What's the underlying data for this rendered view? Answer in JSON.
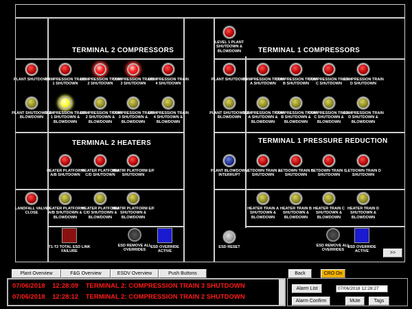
{
  "terminal2": {
    "compressors_title": "TERMINAL 2   COMPRESSORS",
    "heaters_title": "TERMINAL 2      HEATERS",
    "compressor_shutdown": [
      {
        "label": "PLANT SHUTDOWN",
        "state": "red"
      },
      {
        "label": "COMPRESSION TRAIN 1 SHUTDOWN",
        "state": "red"
      },
      {
        "label": "COMPRESSION TRAIN 2 SHUTDOWN",
        "state": "redon"
      },
      {
        "label": "COMPRESSION TRAIN 3 SHUTDOWN",
        "state": "redon"
      },
      {
        "label": "COMPRESSION TRAIN 4 SHUTDOWN",
        "state": "red"
      }
    ],
    "compressor_blowdown": [
      {
        "label": "PLANT SHUTDOWN & BLOWDOWN",
        "state": "yel"
      },
      {
        "label": "COMPRESSION TRAIN 1 SHUTDOWN & BLOWDOWN",
        "state": "yelon"
      },
      {
        "label": "COMPRESSION TRAIN 2 SHUTDOWN & BLOWDOWN",
        "state": "yel"
      },
      {
        "label": "COMPRESSION TRAIN 3 SHUTDOWN & BLOWDOWN",
        "state": "yel"
      },
      {
        "label": "COMPRESSION TRAIN 4 SHUTDOWN & BLOWDOWN",
        "state": "yel"
      }
    ],
    "heater_shutdown": [
      {
        "label": "HEATER PLATFORM A/B SHUTDOWN",
        "state": "red"
      },
      {
        "label": "HEATER PLATFORM C/D SHUTDOWN",
        "state": "red"
      },
      {
        "label": "HEATIR PLATFORM E/F SHUTDOWN",
        "state": "red"
      }
    ],
    "landfall": {
      "label": "LANDFALL VALVE CLOSE",
      "state": "red"
    },
    "heater_blowdown": [
      {
        "label": "HEATER PLATFORM A/B SHUTDOWN & BLOWDOWN",
        "state": "yel"
      },
      {
        "label": "HEATER PLATFORM C/D SHUTDOWN & BLOWDOWN",
        "state": "yel"
      },
      {
        "label": "HEATIR PLATFORM E/F SHUTDOWN & BLOWDOWN",
        "state": "yel"
      }
    ],
    "link_failure": {
      "label": "T1-T2 TOTAL ESD LINK FAILURE",
      "color": "#8a1010"
    },
    "esd_remove": {
      "label": "ESD REMOVE ALL OVERRIDES"
    },
    "esd_override": {
      "label": "ESD OVERRIDE ACTIVE",
      "color": "#1a1ad0"
    }
  },
  "terminal1": {
    "compressors_title": "TERMINAL 1    COMPRESSORS",
    "pressure_title": "TERMINAL 1    PRESSURE REDUCTION",
    "level1": {
      "label": "LEVEL 1 PLANT SHUTDOWN & BLOWDOWN",
      "state": "red"
    },
    "compressor_shutdown": [
      {
        "label": "PLANT SHUTDOWN",
        "state": "red"
      },
      {
        "label": "COMPRESSION TRAIN A SHUTDOWN",
        "state": "red"
      },
      {
        "label": "COMPRESSION TRAIN B SHUTDOWN",
        "state": "red"
      },
      {
        "label": "COMPRESSION TRAIN C SHUTDOWN",
        "state": "red"
      },
      {
        "label": "COMPRESSION TRAIN D SHUTDOWN",
        "state": "red"
      }
    ],
    "compressor_blowdown": [
      {
        "label": "PLANT SHUTDOWN & BLOWDOWN",
        "state": "yel"
      },
      {
        "label": "COMPRESSION TRAIN A SHUTDOWN & BLOWDOWN",
        "state": "yel"
      },
      {
        "label": "COMPRESSION TRAIN B SHUTDOWN & BLOWDOWN",
        "state": "yel"
      },
      {
        "label": "COMPRESSION TRAIN C SHUTDOWN & BLOWDOWN",
        "state": "yel"
      },
      {
        "label": "COMPRESSION TRAIN D SHUTDOWN & BLOWDOWN",
        "state": "yel"
      }
    ],
    "letdown": [
      {
        "label": "PLANT BLOWDOWN INTERRUPT",
        "state": "blue"
      },
      {
        "label": "LETDOWN TRAIN A SHUTDOWN",
        "state": "red"
      },
      {
        "label": "LETDOWN TRAIN B SHUTDOWN",
        "state": "red"
      },
      {
        "label": "LETDOWN TRAIN C SHUTDOWN",
        "state": "red"
      },
      {
        "label": "LETDOWN TRAIN D SHUTDOWN",
        "state": "red"
      }
    ],
    "heater_blowdown": [
      {
        "label": "HEATER TRAIN A SHUTDOWN & BLOWDOWN",
        "state": "yel"
      },
      {
        "label": "HEATER TRAIN B SHUTDOWN & BLOWDOWN",
        "state": "yel"
      },
      {
        "label": "HEATER TRAIN C SHUTDOWN & BLOWDOWN",
        "state": "yel"
      },
      {
        "label": "HEATER TRAIN D SHUTDOWN & BLOWDOWN",
        "state": "yel"
      }
    ],
    "esd_reset": {
      "label": "ESD RESET",
      "state": "grey"
    },
    "esd_remove": {
      "label": "ESD REMOVE ALL OVERRIDES"
    },
    "esd_override": {
      "label": "ESD OVERRIDE ACTIVE",
      "color": "#1a1ad0"
    },
    "next_label": ">>"
  },
  "nav": {
    "plant_overview": "Plant Overview",
    "fg_overview": "F&G Overview",
    "esdv_overview": "ESDV Overview",
    "push_buttons": "Push Buttons",
    "back": "Back",
    "cro_on": "CRO On"
  },
  "alarms": [
    {
      "date": "07/06/2018",
      "time": "12:28:09",
      "message": "TERMINAL 2: COMPRESSION TRAIN 3 SHUTDOWN"
    },
    {
      "date": "07/06/2018",
      "time": "12:28:12",
      "message": "TERMINAL 2: COMPRESSION TRAIN 2 SHUTDOWN"
    }
  ],
  "panel": {
    "alarm_list": "Alarm List",
    "datetime": "07/06/2018   12:28:27",
    "alarm_confirm": "Alarm Confirm",
    "mute": "Mute",
    "tags": "Tags"
  }
}
